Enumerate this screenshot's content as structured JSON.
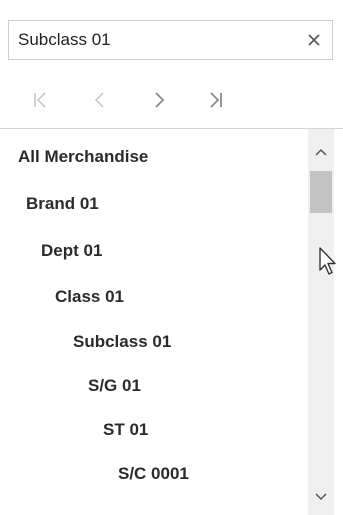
{
  "search": {
    "value": "Subclass 01",
    "clear_icon": "close-icon"
  },
  "nav": {
    "first_icon": "first-page-icon",
    "prev_icon": "previous-icon",
    "next_icon": "next-icon",
    "last_icon": "last-page-icon"
  },
  "tree": {
    "items": [
      {
        "label": "All Merchandise",
        "level": 0
      },
      {
        "label": "Brand 01",
        "level": 1
      },
      {
        "label": "Dept 01",
        "level": 2
      },
      {
        "label": "Class 01",
        "level": 3
      },
      {
        "label": "Subclass 01",
        "level": 4
      },
      {
        "label": "S/G 01",
        "level": 5
      },
      {
        "label": "ST 01",
        "level": 6
      },
      {
        "label": "S/C 0001",
        "level": 7
      }
    ]
  },
  "scrollbar": {
    "up_icon": "chevron-up-icon",
    "down_icon": "chevron-down-icon",
    "position": 0.05
  },
  "colors": {
    "text": "#2b2b2b",
    "border": "#cfcfcf",
    "nav_disabled": "#c8c8c8",
    "nav_enabled": "#8a8a8a",
    "scroll_track": "#f0f0f0",
    "scroll_thumb": "#c2c2c2"
  }
}
